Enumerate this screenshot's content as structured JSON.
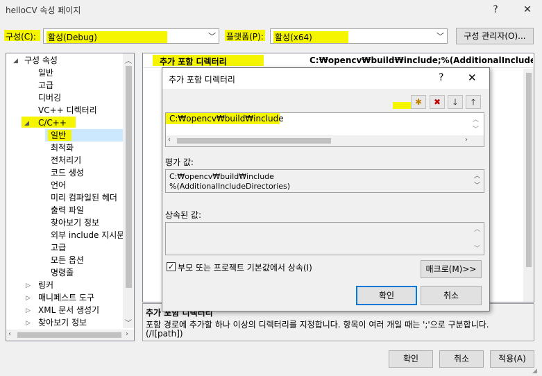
{
  "window": {
    "title": "helloCV 속성 페이지",
    "help_label": "?",
    "close_label": "✕"
  },
  "config": {
    "config_label": "구성(C):",
    "config_value": "활성(Debug)",
    "platform_label": "플랫폼(P):",
    "platform_value": "활성(x64)",
    "manager_button": "구성 관리자(O)..."
  },
  "tree": {
    "items": [
      {
        "label": "구성 속성",
        "expander": "◢"
      },
      {
        "label": "일반"
      },
      {
        "label": "고급"
      },
      {
        "label": "디버깅"
      },
      {
        "label": "VC++ 디렉터리"
      },
      {
        "label": "C/C++",
        "expander": "◢"
      },
      {
        "label": "일반"
      },
      {
        "label": "최적화"
      },
      {
        "label": "전처리기"
      },
      {
        "label": "코드 생성"
      },
      {
        "label": "언어"
      },
      {
        "label": "미리 컴파일된 헤더"
      },
      {
        "label": "출력 파일"
      },
      {
        "label": "찾아보기 정보"
      },
      {
        "label": "외부 include 지시문"
      },
      {
        "label": "고급"
      },
      {
        "label": "모든 옵션"
      },
      {
        "label": "명령줄"
      },
      {
        "label": "링커",
        "expander": "▷"
      },
      {
        "label": "매니페스트 도구",
        "expander": "▷"
      },
      {
        "label": "XML 문서 생성기",
        "expander": "▷"
      },
      {
        "label": "찾아보기 정보",
        "expander": "▷"
      }
    ]
  },
  "grid": {
    "property_name": "추가 포함 디렉터리",
    "property_value": "C:₩opencv₩build₩include;%(AdditionalIncludeDirecto"
  },
  "description": {
    "title": "추가 포함 디렉터리",
    "text": "포함 경로에 추가할 하나 이상의 디렉터리를 지정합니다. 항목이 여러 개일 때는 ';'으로 구분합니다.",
    "switch": "(/I[path])"
  },
  "dialog": {
    "title": "추가 포함 디렉터리",
    "help_label": "?",
    "close_label": "✕",
    "toolbar": {
      "new_line": "✱",
      "delete": "✖",
      "move_down": "🡓",
      "move_up": "🡑"
    },
    "entry": "C:₩opencv₩build₩include",
    "evaluated_label": "평가 값:",
    "evaluated_lines": [
      "C:₩opencv₩build₩include",
      "%(AdditionalIncludeDirectories)"
    ],
    "inherited_label": "상속된 값:",
    "inherit_checkbox_label": "부모 또는 프로젝트 기본값에서 상속(I)",
    "inherit_checked": true,
    "macro_button": "매크로(M)>>",
    "ok_button": "확인",
    "cancel_button": "취소"
  },
  "footer": {
    "ok_button": "확인",
    "cancel_button": "취소",
    "apply_button": "적용(A)"
  },
  "colors": {
    "highlight": "#f5f500",
    "accent": "#0078d7",
    "selection": "#cce8ff"
  }
}
